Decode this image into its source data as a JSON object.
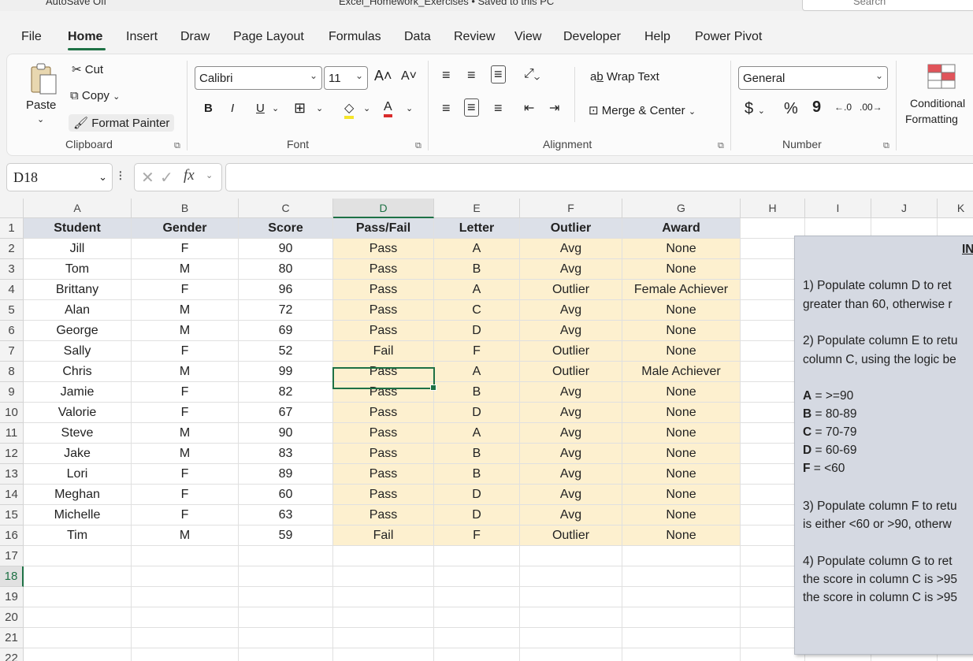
{
  "titlebar": {
    "autosave": "AutoSave",
    "autosave_state": "Off",
    "doc_title": "Excel_Homework_Exercises • Saved to this PC",
    "search_placeholder": "Search"
  },
  "menu": [
    "File",
    "Home",
    "Insert",
    "Draw",
    "Page Layout",
    "Formulas",
    "Data",
    "Review",
    "View",
    "Developer",
    "Help",
    "Power Pivot"
  ],
  "ribbon": {
    "clipboard": {
      "paste": "Paste",
      "cut": "Cut",
      "copy": "Copy",
      "format_painter": "Format Painter",
      "group": "Clipboard"
    },
    "font": {
      "name": "Calibri",
      "size": "11",
      "bold": "B",
      "italic": "I",
      "underline": "U",
      "group": "Font"
    },
    "alignment": {
      "wrap": "Wrap Text",
      "merge": "Merge & Center",
      "group": "Alignment"
    },
    "number": {
      "format": "General",
      "currency": "$",
      "percent": "%",
      "comma": "9",
      "group": "Number"
    },
    "styles": {
      "cond_line1": "Conditional",
      "cond_line2": "Formatting"
    }
  },
  "formula_bar": {
    "name_box": "D18",
    "fx": "fx",
    "formula": ""
  },
  "columns": [
    "A",
    "B",
    "C",
    "D",
    "E",
    "F",
    "G",
    "H",
    "I",
    "J",
    "K"
  ],
  "rows": [
    "1",
    "2",
    "3",
    "4",
    "5",
    "6",
    "7",
    "8",
    "9",
    "10",
    "11",
    "12",
    "13",
    "14",
    "15",
    "16",
    "17",
    "18",
    "19",
    "20",
    "21",
    "22"
  ],
  "table": {
    "headers": [
      "Student",
      "Gender",
      "Score",
      "Pass/Fail",
      "Letter",
      "Outlier",
      "Award"
    ],
    "rows": [
      [
        "Jill",
        "F",
        "90",
        "Pass",
        "A",
        "Avg",
        "None"
      ],
      [
        "Tom",
        "M",
        "80",
        "Pass",
        "B",
        "Avg",
        "None"
      ],
      [
        "Brittany",
        "F",
        "96",
        "Pass",
        "A",
        "Outlier",
        "Female Achiever"
      ],
      [
        "Alan",
        "M",
        "72",
        "Pass",
        "C",
        "Avg",
        "None"
      ],
      [
        "George",
        "M",
        "69",
        "Pass",
        "D",
        "Avg",
        "None"
      ],
      [
        "Sally",
        "F",
        "52",
        "Fail",
        "F",
        "Outlier",
        "None"
      ],
      [
        "Chris",
        "M",
        "99",
        "Pass",
        "A",
        "Outlier",
        "Male Achiever"
      ],
      [
        "Jamie",
        "F",
        "82",
        "Pass",
        "B",
        "Avg",
        "None"
      ],
      [
        "Valorie",
        "F",
        "67",
        "Pass",
        "D",
        "Avg",
        "None"
      ],
      [
        "Steve",
        "M",
        "90",
        "Pass",
        "A",
        "Avg",
        "None"
      ],
      [
        "Jake",
        "M",
        "83",
        "Pass",
        "B",
        "Avg",
        "None"
      ],
      [
        "Lori",
        "F",
        "89",
        "Pass",
        "B",
        "Avg",
        "None"
      ],
      [
        "Meghan",
        "F",
        "60",
        "Pass",
        "D",
        "Avg",
        "None"
      ],
      [
        "Michelle",
        "F",
        "63",
        "Pass",
        "D",
        "Avg",
        "None"
      ],
      [
        "Tim",
        "M",
        "59",
        "Fail",
        "F",
        "Outlier",
        "None"
      ]
    ]
  },
  "instructions": {
    "title": "IN",
    "l1": "1) Populate column D to ret",
    "l2": "greater than 60, otherwise r",
    "l3": "2) Populate column E to retu",
    "l4": "column C, using the logic be",
    "g1": "A",
    "g1v": " = >=90",
    "g2": "B",
    "g2v": " = 80-89",
    "g3": "C",
    "g3v": " = 70-79",
    "g4": "D",
    "g4v": " = 60-69",
    "g5": "F",
    "g5v": " = <60",
    "l5": "3) Populate column F to retu",
    "l6": "is either <60 or >90, otherw",
    "l7": "4) Populate column G to ret",
    "l8": "the score in column C is >95",
    "l9": "the score in column C is >95"
  },
  "colors": {
    "accent": "#1e7145",
    "header_fill": "#dce0e8",
    "answer_fill": "#fdf0cf",
    "panel_fill": "#d5d9e2"
  }
}
